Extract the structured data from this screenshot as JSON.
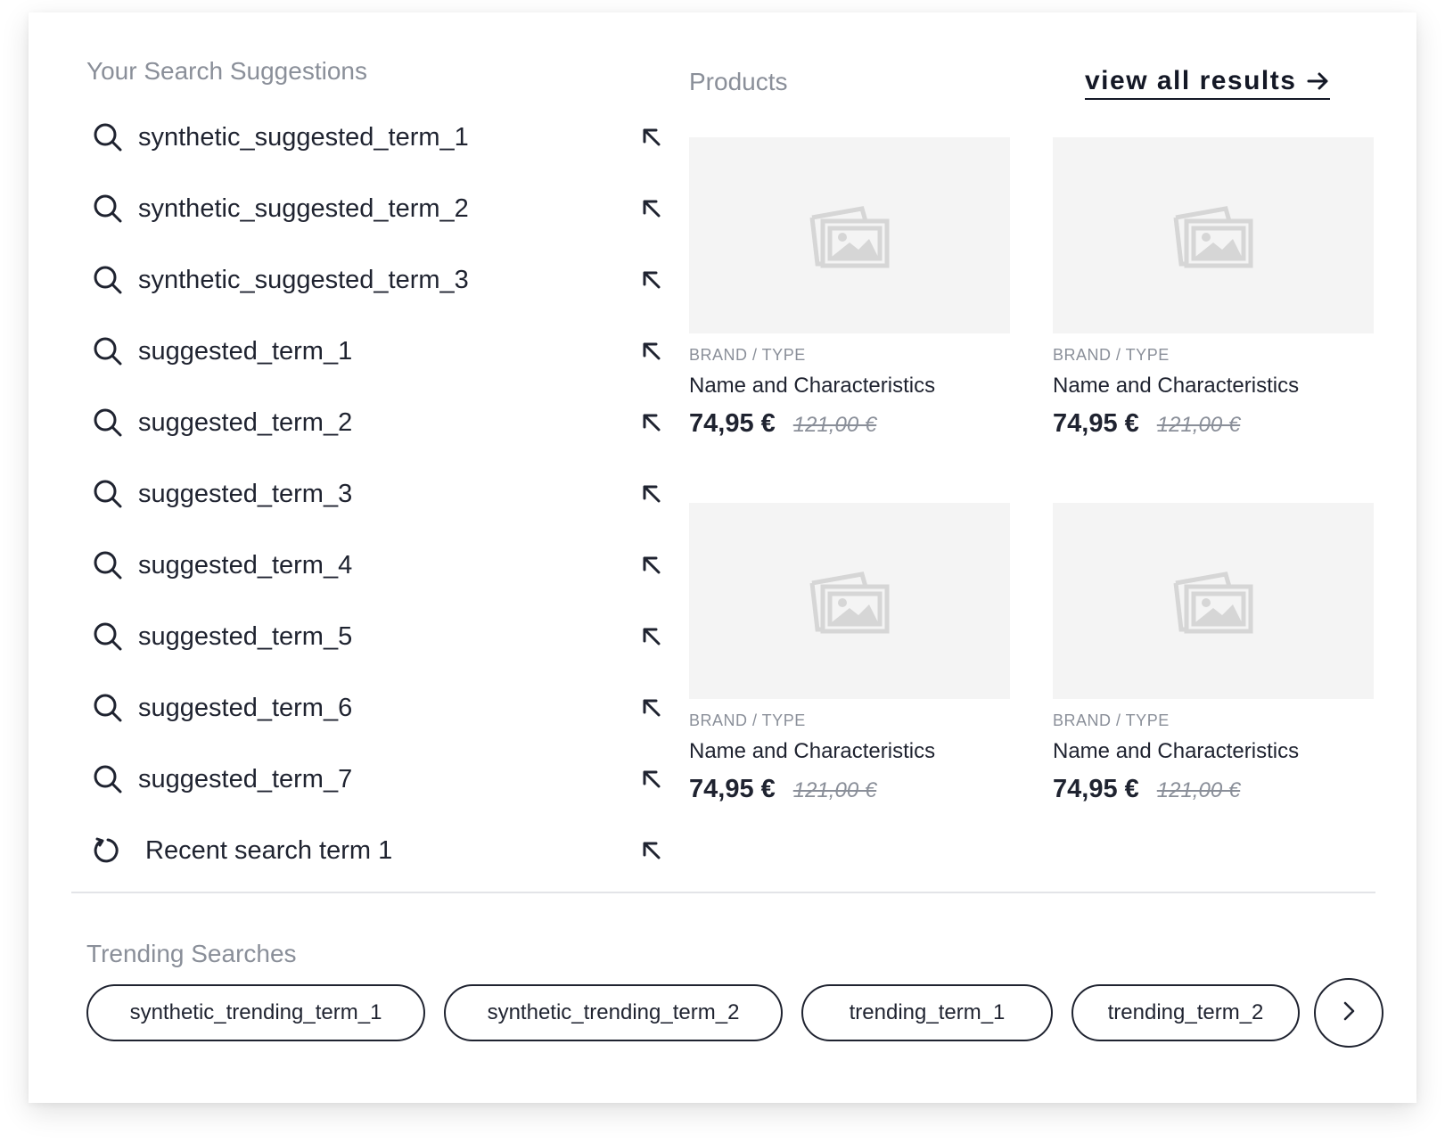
{
  "suggestions": {
    "title": "Your Search Suggestions",
    "items": [
      {
        "label": "synthetic_suggested_term_1",
        "icon": "search-icon"
      },
      {
        "label": "synthetic_suggested_term_2",
        "icon": "search-icon"
      },
      {
        "label": "synthetic_suggested_term_3",
        "icon": "search-icon"
      },
      {
        "label": "suggested_term_1",
        "icon": "search-icon"
      },
      {
        "label": "suggested_term_2",
        "icon": "search-icon"
      },
      {
        "label": "suggested_term_3",
        "icon": "search-icon"
      },
      {
        "label": "suggested_term_4",
        "icon": "search-icon"
      },
      {
        "label": "suggested_term_5",
        "icon": "search-icon"
      },
      {
        "label": "suggested_term_6",
        "icon": "search-icon"
      },
      {
        "label": "suggested_term_7",
        "icon": "search-icon"
      },
      {
        "label": "Recent search term 1",
        "icon": "history-icon"
      }
    ]
  },
  "products": {
    "title": "Products",
    "view_all_label": "view all results",
    "items": [
      {
        "brand": "BRAND / TYPE",
        "name": "Name and Characteristics",
        "price": "74,95 €",
        "old_price": "121,00 €"
      },
      {
        "brand": "BRAND / TYPE",
        "name": "Name and Characteristics",
        "price": "74,95 €",
        "old_price": "121,00 €"
      },
      {
        "brand": "BRAND / TYPE",
        "name": "Name and Characteristics",
        "price": "74,95 €",
        "old_price": "121,00 €"
      },
      {
        "brand": "BRAND / TYPE",
        "name": "Name and Characteristics",
        "price": "74,95 €",
        "old_price": "121,00 €"
      }
    ]
  },
  "trending": {
    "title": "Trending Searches",
    "chips": [
      "synthetic_trending_term_1",
      "synthetic_trending_term_2",
      "trending_term_1",
      "trending_term_2"
    ]
  },
  "colors": {
    "text": "#1f2330",
    "muted": "#8a8f99",
    "placeholder_bg": "#f4f4f4",
    "divider": "#e3e4e8"
  }
}
